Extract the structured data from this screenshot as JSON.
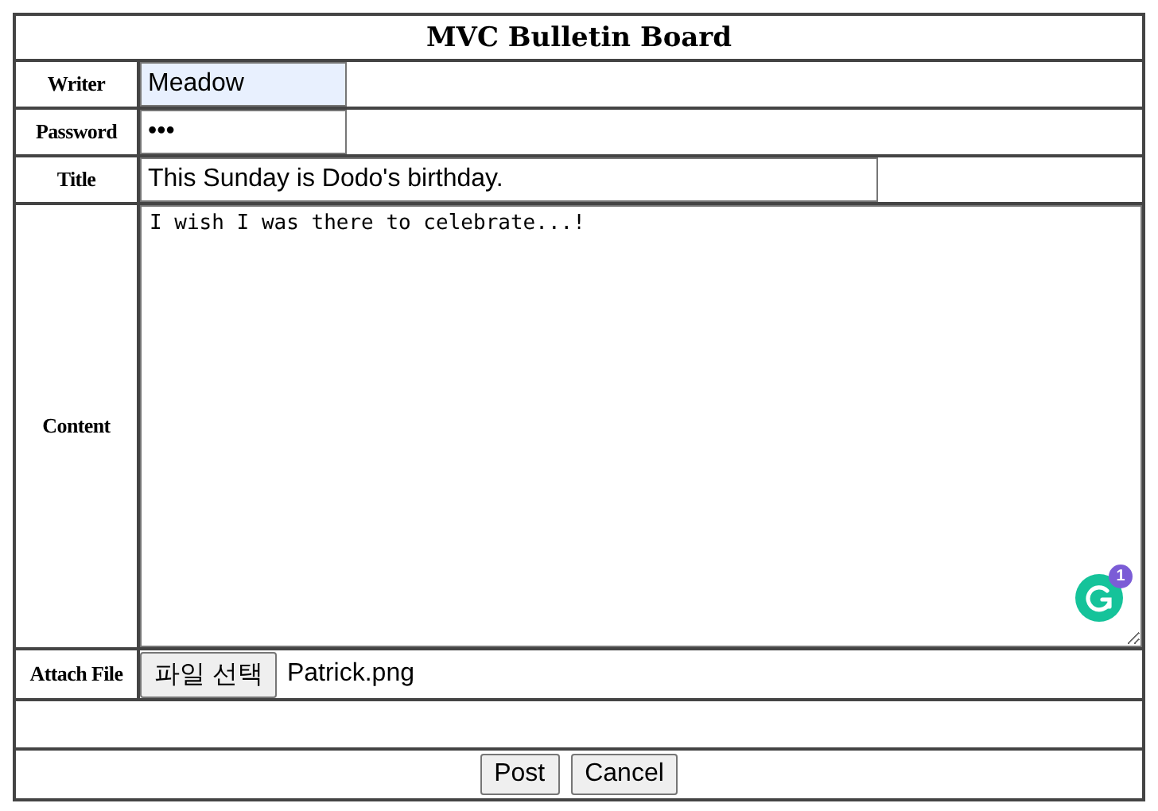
{
  "board": {
    "title": "MVC Bulletin Board"
  },
  "fields": [
    {
      "kind": "text",
      "label": "Writer",
      "value": "Meadow",
      "autofilled": true
    },
    {
      "kind": "password",
      "label": "Password",
      "value": "•••",
      "autofilled": false
    },
    {
      "kind": "title",
      "label": "Title",
      "value": "This Sunday is Dodo's birthday.",
      "autofilled": false
    },
    {
      "kind": "textarea",
      "label": "Content",
      "value": "I wish I was there to celebrate...!",
      "badge_count": "1"
    },
    {
      "kind": "file",
      "label": "Attach File",
      "button": "파일 선택",
      "value": "Patrick.png"
    }
  ],
  "buttons": [
    "Post",
    "Cancel"
  ]
}
